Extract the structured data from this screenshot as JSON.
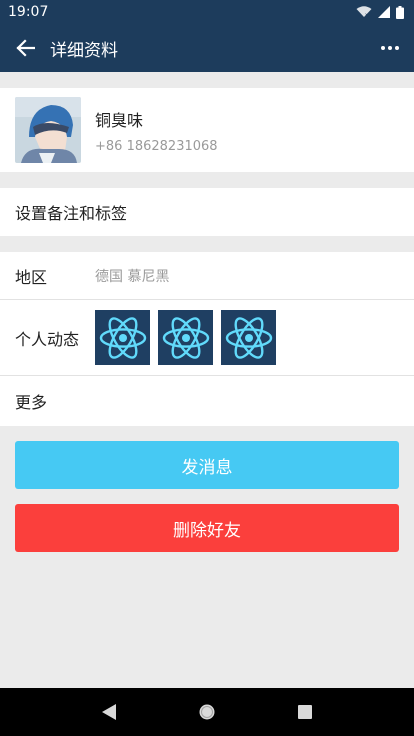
{
  "status_bar": {
    "time": "19:07"
  },
  "app_bar": {
    "title": "详细资料"
  },
  "profile": {
    "name": "铜臭味",
    "phone": "+86 18628231068"
  },
  "remark": {
    "label": "设置备注和标签"
  },
  "region": {
    "label": "地区",
    "value": "德国 慕尼黑"
  },
  "moments": {
    "label": "个人动态",
    "thumb_icons": [
      "react-logo-icon",
      "react-logo-icon",
      "react-logo-icon"
    ]
  },
  "more": {
    "label": "更多"
  },
  "actions": {
    "send_message": "发消息",
    "delete_friend": "删除好友"
  },
  "colors": {
    "header": "#1d3c5c",
    "primary_button": "#46c9f3",
    "danger_button": "#fb3f3c",
    "react_blue": "#61dafb"
  }
}
